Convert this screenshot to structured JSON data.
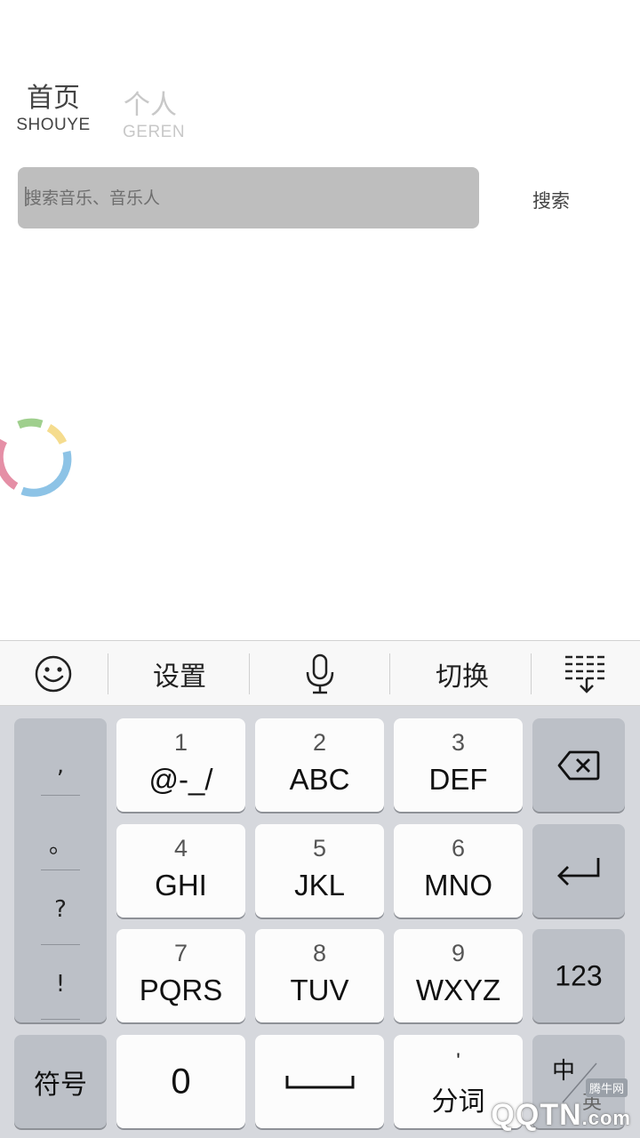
{
  "nav": {
    "home": {
      "cn": "首页",
      "en": "SHOUYE"
    },
    "personal": {
      "cn": "个人",
      "en": "GEREN"
    }
  },
  "search": {
    "placeholder": "搜索音乐、音乐人",
    "value": "",
    "button_label": "搜索"
  },
  "keyboard": {
    "toolbar": {
      "settings": "设置",
      "switch": "切换",
      "icons": [
        "smiley-icon",
        "microphone-icon",
        "keyboard-collapse-icon"
      ]
    },
    "punctuation": [
      ",",
      "。",
      "?",
      "!"
    ],
    "keys": [
      {
        "num": "1",
        "letters": "@-_/"
      },
      {
        "num": "2",
        "letters": "ABC"
      },
      {
        "num": "3",
        "letters": "DEF"
      },
      {
        "num": "4",
        "letters": "GHI"
      },
      {
        "num": "5",
        "letters": "JKL"
      },
      {
        "num": "6",
        "letters": "MNO"
      },
      {
        "num": "7",
        "letters": "PQRS"
      },
      {
        "num": "8",
        "letters": "TUV"
      },
      {
        "num": "9",
        "letters": "WXYZ"
      }
    ],
    "numeric_label": "123",
    "symbols_label": "符号",
    "zero_label": "0",
    "split_label": "分词",
    "split_mark": "'",
    "lang_top": "中",
    "lang_bottom": "英",
    "icons": [
      "backspace-icon",
      "return-icon",
      "space-icon"
    ]
  },
  "watermark": {
    "text": "QQTN",
    "suffix": ".com",
    "tag": "腾牛网"
  },
  "colors": {
    "spinner": [
      "#e58fa6",
      "#9fcf8d",
      "#f5dc8e",
      "#8dc3e6"
    ]
  }
}
